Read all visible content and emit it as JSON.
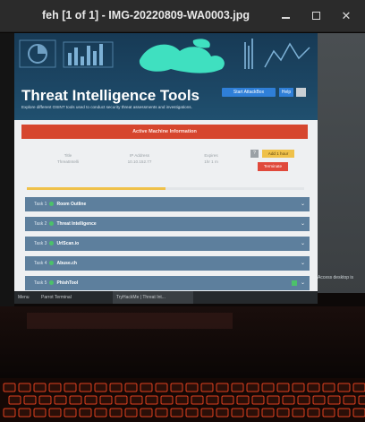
{
  "window": {
    "title": "feh [1 of 1] - IMG-20220809-WA0003.jpg",
    "controls": {
      "minimize": "–",
      "close": "✕"
    }
  },
  "page": {
    "banner_title": "Threat Intelligence Tools",
    "banner_subtitle": "Explore different OSINT tools used to conduct security threat assessments and investigations.",
    "start_attack_label": "Start AttackBox",
    "help_label": "Help",
    "active_machine_label": "Active Machine Information",
    "info": [
      {
        "label": "Title",
        "value": "ThreatIntelli"
      },
      {
        "label": "IP Address",
        "value": "10.10.152.77"
      },
      {
        "label": "Expires",
        "value": "1hr 1 m"
      }
    ],
    "question_btn": "?",
    "add_time_label": "Add 1 hour",
    "terminate_label": "Terminate",
    "progress_fraction": 0.5,
    "tasks": [
      {
        "num": "Task 1",
        "name": "Room Outline"
      },
      {
        "num": "Task 2",
        "name": "Threat Intelligence"
      },
      {
        "num": "Task 3",
        "name": "UrlScan.io"
      },
      {
        "num": "Task 4",
        "name": "Abuse.ch"
      },
      {
        "num": "Task 5",
        "name": "PhishTool"
      }
    ]
  },
  "taskbar": {
    "menu": "Menu",
    "terminal": "Parrot Terminal",
    "browser": "TryHackMe | Threat Int..."
  },
  "right_note": "Access desktop is"
}
